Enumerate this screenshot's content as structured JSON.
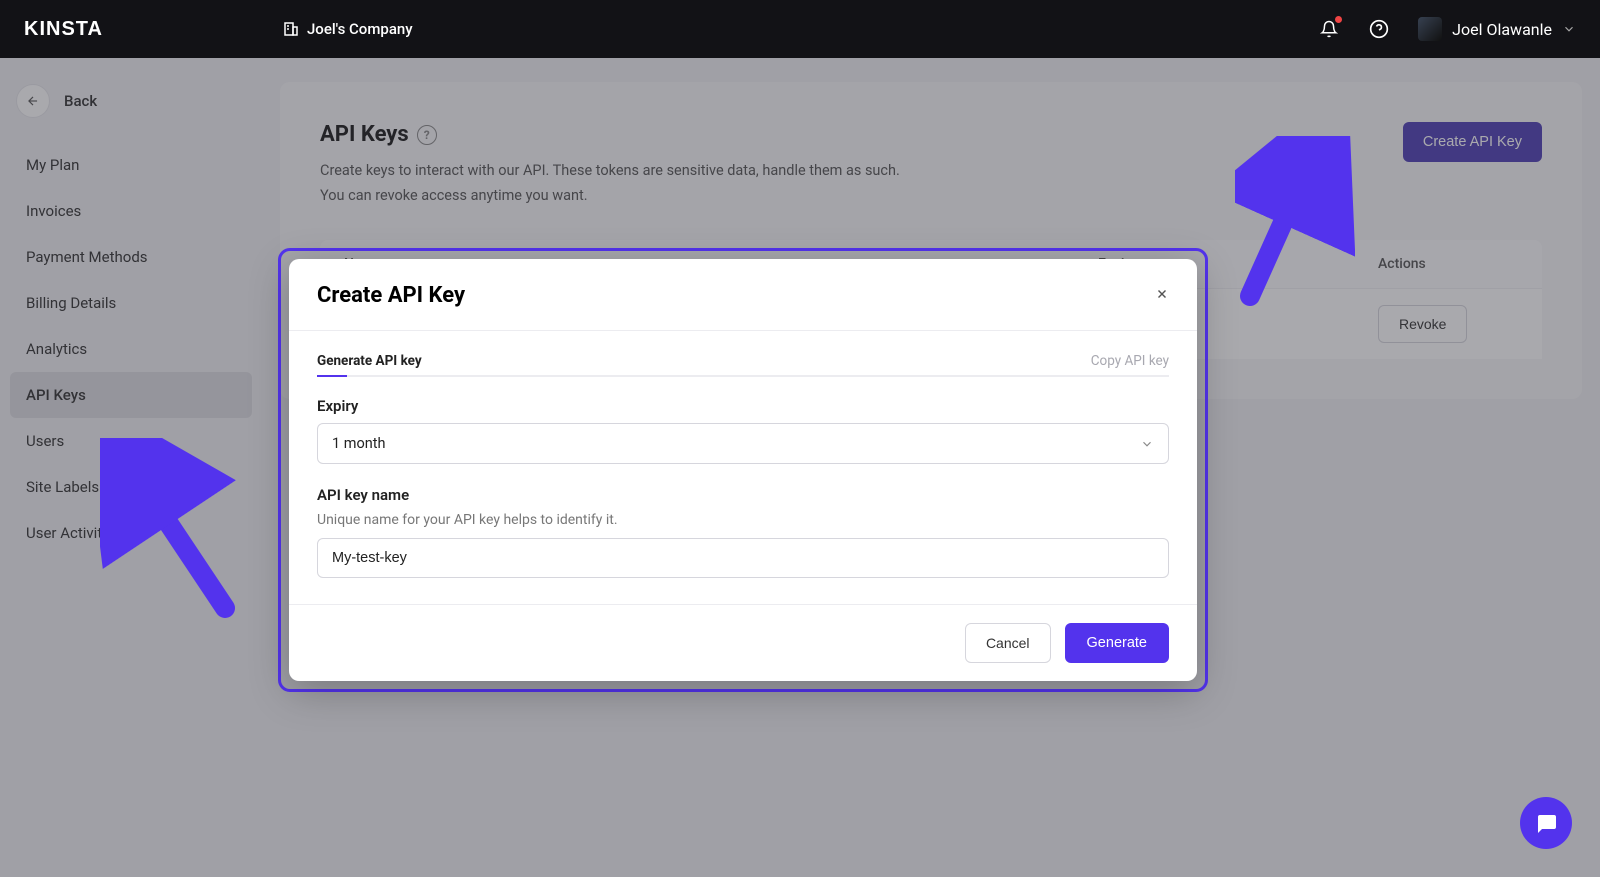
{
  "header": {
    "logo": "KINSTA",
    "company": "Joel's Company",
    "user_name": "Joel Olawanle"
  },
  "sidebar": {
    "back_label": "Back",
    "items": [
      {
        "label": "My Plan"
      },
      {
        "label": "Invoices"
      },
      {
        "label": "Payment Methods"
      },
      {
        "label": "Billing Details"
      },
      {
        "label": "Analytics"
      },
      {
        "label": "API Keys"
      },
      {
        "label": "Users"
      },
      {
        "label": "Site Labels"
      },
      {
        "label": "User Activity"
      }
    ],
    "active_index": 5
  },
  "page": {
    "title": "API Keys",
    "desc_line1": "Create keys to interact with our API. These tokens are sensitive data, handle them as such.",
    "desc_line2": "You can revoke access anytime you want.",
    "create_button": "Create API Key",
    "table": {
      "headers": {
        "name": "Name",
        "expiry": "Expiry",
        "actions": "Actions"
      },
      "row": {
        "revoke": "Revoke"
      }
    }
  },
  "modal": {
    "title": "Create API Key",
    "step_active": "Generate API key",
    "step_inactive": "Copy API key",
    "expiry_label": "Expiry",
    "expiry_value": "1 month",
    "name_label": "API key name",
    "name_hint": "Unique name for your API key helps to identify it.",
    "name_value": "My-test-key",
    "cancel": "Cancel",
    "generate": "Generate"
  },
  "colors": {
    "accent": "#5333ed",
    "header_button": "#4e3fb5"
  }
}
